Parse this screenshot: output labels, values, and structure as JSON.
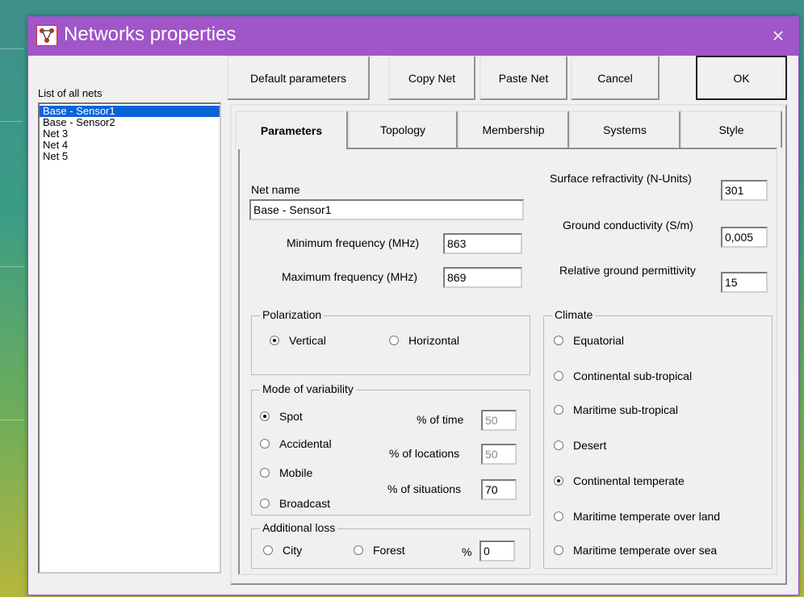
{
  "window": {
    "title": "Networks properties",
    "close_symbol": "×"
  },
  "toolbar": {
    "default_label": "Default parameters",
    "copy_label": "Copy Net",
    "paste_label": "Paste Net",
    "cancel_label": "Cancel",
    "ok_label": "OK"
  },
  "nets": {
    "label": "List of all nets",
    "items": [
      "Base - Sensor1",
      "Base - Sensor2",
      "Net 3",
      "Net 4",
      "Net 5"
    ],
    "selected_index": 0
  },
  "tabs": [
    "Parameters",
    "Topology",
    "Membership",
    "Systems",
    "Style"
  ],
  "active_tab": "Parameters",
  "params": {
    "net_name_label": "Net name",
    "net_name": "Base - Sensor1",
    "min_freq_label": "Minimum frequency (MHz)",
    "min_freq": "863",
    "max_freq_label": "Maximum frequency (MHz)",
    "max_freq": "869",
    "refractivity_label": "Surface refractivity (N-Units)",
    "refractivity": "301",
    "conductivity_label": "Ground conductivity (S/m)",
    "conductivity": "0,005",
    "permittivity_label": "Relative ground permittivity",
    "permittivity": "15"
  },
  "polarization": {
    "title": "Polarization",
    "options": [
      "Vertical",
      "Horizontal"
    ],
    "selected": "Vertical"
  },
  "variability": {
    "title": "Mode of variability",
    "options": [
      "Spot",
      "Accidental",
      "Mobile",
      "Broadcast"
    ],
    "selected": "Spot",
    "time_label": "% of time",
    "time_value": "50",
    "locations_label": "% of locations",
    "locations_value": "50",
    "situations_label": "% of situations",
    "situations_value": "70"
  },
  "loss": {
    "title": "Additional loss",
    "options": [
      "City",
      "Forest"
    ],
    "percent_label": "%",
    "percent_value": "0"
  },
  "climate": {
    "title": "Climate",
    "options": [
      "Equatorial",
      "Continental sub-tropical",
      "Maritime sub-tropical",
      "Desert",
      "Continental temperate",
      "Maritime temperate over land",
      "Maritime temperate over sea"
    ],
    "selected": "Continental temperate"
  },
  "colors": {
    "title_bar": "#a055c9",
    "selection": "#0a64d8"
  },
  "icons": {
    "app": "network-app-icon",
    "close": "close-icon"
  }
}
